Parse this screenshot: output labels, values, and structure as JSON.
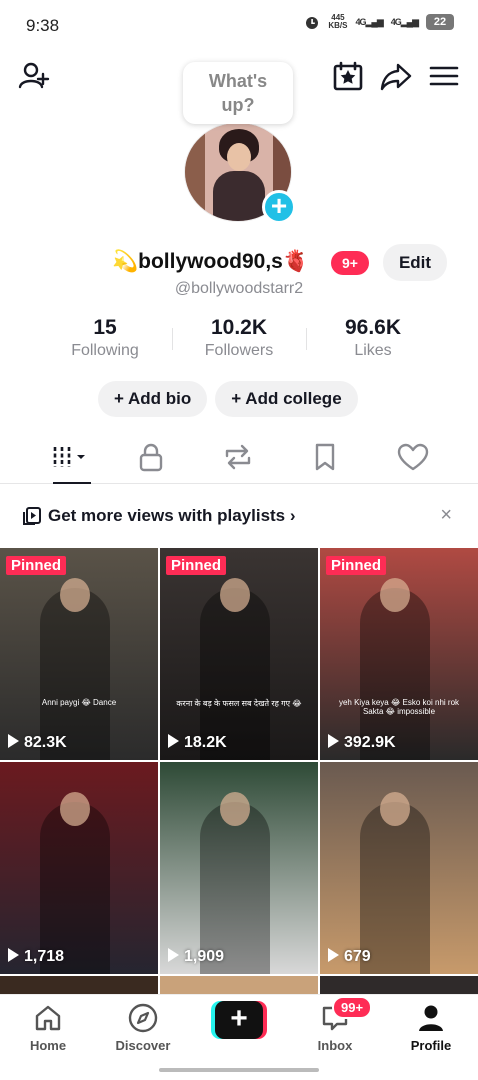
{
  "status_bar": {
    "time": "9:38",
    "net_speed_top": "445",
    "net_speed_unit": "KB/S",
    "signal1": "4G",
    "signal2": "4G",
    "battery": "22"
  },
  "header": {
    "bubble_line1": "What's",
    "bubble_line2": "up?"
  },
  "profile": {
    "display_name": "💫bollywood90,s🫀",
    "notif_badge": "9+",
    "edit_label": "Edit",
    "handle": "@bollywoodstarr2",
    "stats": [
      {
        "num": "15",
        "label": "Following"
      },
      {
        "num": "10.2K",
        "label": "Followers"
      },
      {
        "num": "96.6K",
        "label": "Likes"
      }
    ],
    "add_bio": "+ Add bio",
    "add_college": "+ Add college"
  },
  "playlist_banner": {
    "text": "Get more views with playlists ›",
    "close": "×"
  },
  "videos": [
    {
      "pinned": "Pinned",
      "views": "82.3K",
      "bg": "#5a5348",
      "accent": "#2b2b2b",
      "caption": "Anni paygi 😂 Dance"
    },
    {
      "pinned": "Pinned",
      "views": "18.2K",
      "bg": "#3a3432",
      "accent": "#1a1818",
      "caption": "करना के बड़ के फसल सब देखते रह गए 😂"
    },
    {
      "pinned": "Pinned",
      "views": "392.9K",
      "bg": "#b04a43",
      "accent": "#2a2a2a",
      "caption": "yeh Kiya keya 😂 Esko koi nhi rok Sakta 😂 impossible"
    },
    {
      "pinned": "",
      "views": "1,718",
      "bg": "#6b1a1f",
      "accent": "#252530",
      "caption": ""
    },
    {
      "pinned": "",
      "views": "1,909",
      "bg": "#2e4a36",
      "accent": "#d8d8d8",
      "caption": ""
    },
    {
      "pinned": "",
      "views": "679",
      "bg": "#6a5a50",
      "accent": "#c79a6b",
      "caption": ""
    }
  ],
  "bottom_nav": {
    "home": "Home",
    "discover": "Discover",
    "inbox": "Inbox",
    "inbox_badge": "99+",
    "profile": "Profile",
    "create": "+"
  },
  "colors": {
    "accent_red": "#fe2c55",
    "accent_cyan": "#25f4ee",
    "avatar_plus": "#21c0e6"
  }
}
